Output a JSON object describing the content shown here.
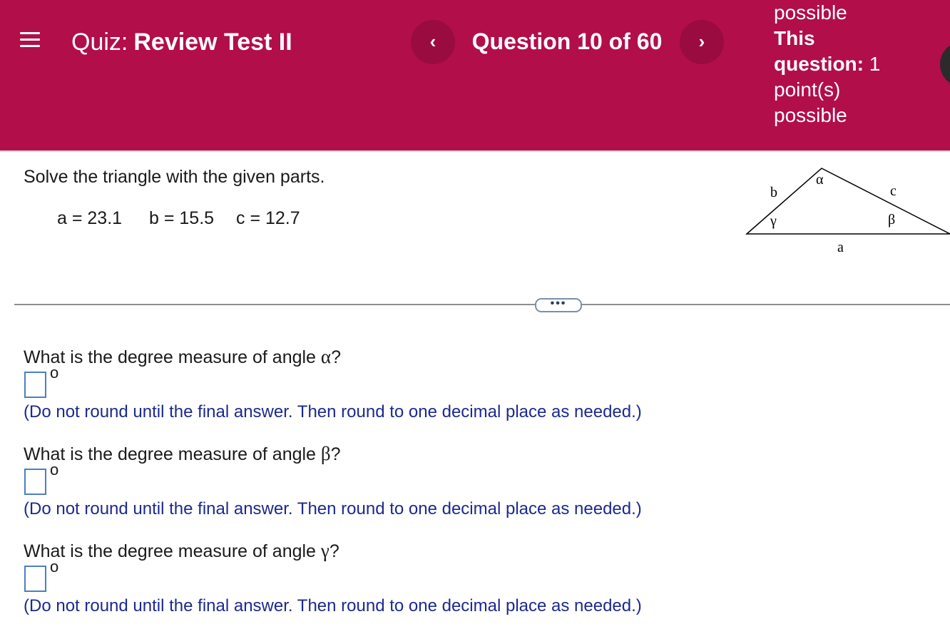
{
  "header": {
    "quiz_prefix": "Quiz:",
    "quiz_title": "Review Test II",
    "prev_label": "‹",
    "next_label": "›",
    "question_counter": "Question 10 of 60",
    "points": {
      "line_possible_top": "possible",
      "this_question_label": "This",
      "question_label": "question:",
      "points_value": "1",
      "points_unit": "point(s)",
      "line_possible": "possible"
    }
  },
  "problem": {
    "instruction": "Solve the triangle with the given parts.",
    "given": {
      "a": "a = 23.1",
      "b": "b = 15.5",
      "c": "c = 12.7"
    }
  },
  "figure": {
    "label_b": "b",
    "label_alpha": "α",
    "label_c": "c",
    "label_gamma": "γ",
    "label_beta": "β",
    "label_a": "a"
  },
  "divider": {
    "more_label": "•••"
  },
  "questions": [
    {
      "prefix": "What is the degree measure of angle ",
      "symbol": "α",
      "suffix": "?",
      "degree": "o",
      "value": "",
      "hint": "(Do not round until the final answer. Then round to one decimal place as needed.)"
    },
    {
      "prefix": "What is the degree measure of angle ",
      "symbol": "β",
      "suffix": "?",
      "degree": "o",
      "value": "",
      "hint": "(Do not round until the final answer. Then round to one decimal place as needed.)"
    },
    {
      "prefix": "What is the degree measure of angle ",
      "symbol": "γ",
      "suffix": "?",
      "degree": "o",
      "value": "",
      "hint": "(Do not round until the final answer. Then round to one decimal place as needed.)"
    }
  ],
  "colors": {
    "header_bg": "#b10e4a",
    "hint_text": "#1c2a8c",
    "answer_border": "#4a7fc3"
  }
}
